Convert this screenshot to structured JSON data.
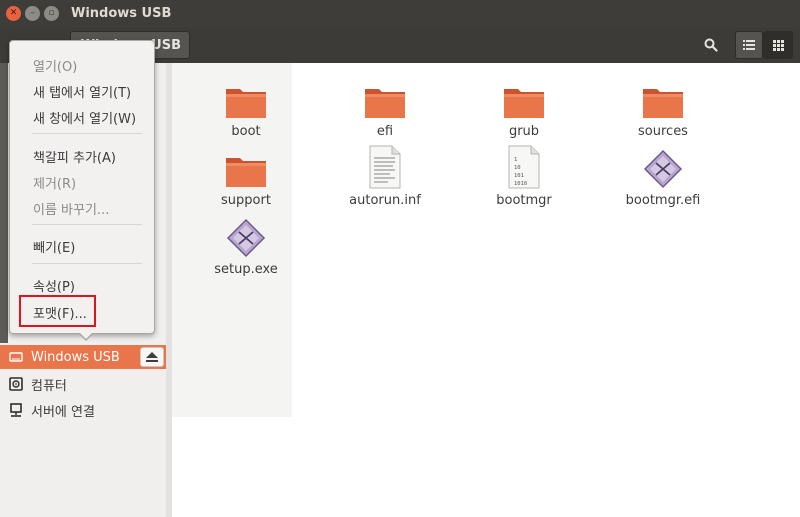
{
  "window": {
    "title": "Windows USB"
  },
  "toolbar": {
    "path_label": "Windows USB"
  },
  "menu": {
    "items": [
      {
        "label": "열기(O)",
        "disabled": true
      },
      {
        "label": "새 탭에서 열기(T)",
        "disabled": false
      },
      {
        "label": "새 창에서 열기(W)",
        "disabled": false
      },
      {
        "label": "책갈피 추가(A)",
        "disabled": false
      },
      {
        "label": "제거(R)",
        "disabled": true
      },
      {
        "label": "이름 바꾸기...",
        "disabled": true
      },
      {
        "label": "빼기(E)",
        "disabled": false
      },
      {
        "label": "속성(P)",
        "disabled": false
      },
      {
        "label": "포맷(F)...",
        "disabled": false
      }
    ]
  },
  "sidebar": {
    "items": [
      {
        "label": "Windows USB",
        "icon": "drive-icon",
        "active": true
      },
      {
        "label": "컴퓨터",
        "icon": "computer-icon",
        "active": false
      },
      {
        "label": "서버에 연결",
        "icon": "network-server-icon",
        "active": false
      }
    ]
  },
  "files": [
    {
      "name": "boot",
      "type": "folder"
    },
    {
      "name": "efi",
      "type": "folder"
    },
    {
      "name": "grub",
      "type": "folder"
    },
    {
      "name": "sources",
      "type": "folder"
    },
    {
      "name": "support",
      "type": "folder"
    },
    {
      "name": "autorun.inf",
      "type": "text"
    },
    {
      "name": "bootmgr",
      "type": "binary",
      "binary_text": [
        "1",
        "10",
        "101",
        "1010"
      ]
    },
    {
      "name": "bootmgr.efi",
      "type": "executable"
    },
    {
      "name": "setup.exe",
      "type": "executable"
    }
  ],
  "colors": {
    "accent": "#e9754a",
    "folder": "#e9754a",
    "highlight_box": "#e0141e"
  }
}
